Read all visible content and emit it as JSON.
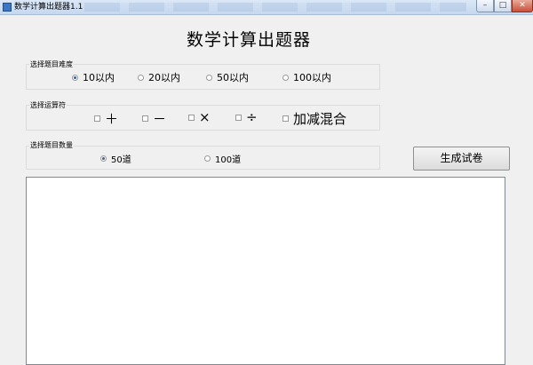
{
  "window": {
    "title": "数学计算出题器1.1",
    "buttons": {
      "minimize": "–",
      "maximize": "□",
      "close": "✕"
    }
  },
  "heading": "数学计算出题器",
  "difficulty": {
    "label": "选择题目难度",
    "options": [
      {
        "label": "10以内",
        "selected": true
      },
      {
        "label": "20以内",
        "selected": false
      },
      {
        "label": "50以内",
        "selected": false
      },
      {
        "label": "100以内",
        "selected": false
      }
    ]
  },
  "operators": {
    "label": "选择运算符",
    "options": [
      {
        "label": "＋",
        "checked": false
      },
      {
        "label": "－",
        "checked": false
      },
      {
        "label": "×",
        "checked": false
      },
      {
        "label": "÷",
        "checked": false
      },
      {
        "label": "加减混合",
        "checked": false
      }
    ]
  },
  "count": {
    "label": "选择题目数量",
    "options": [
      {
        "label": "50道",
        "selected": true
      },
      {
        "label": "100道",
        "selected": false
      }
    ]
  },
  "generate_button": "生成试卷",
  "output": {
    "value": ""
  }
}
